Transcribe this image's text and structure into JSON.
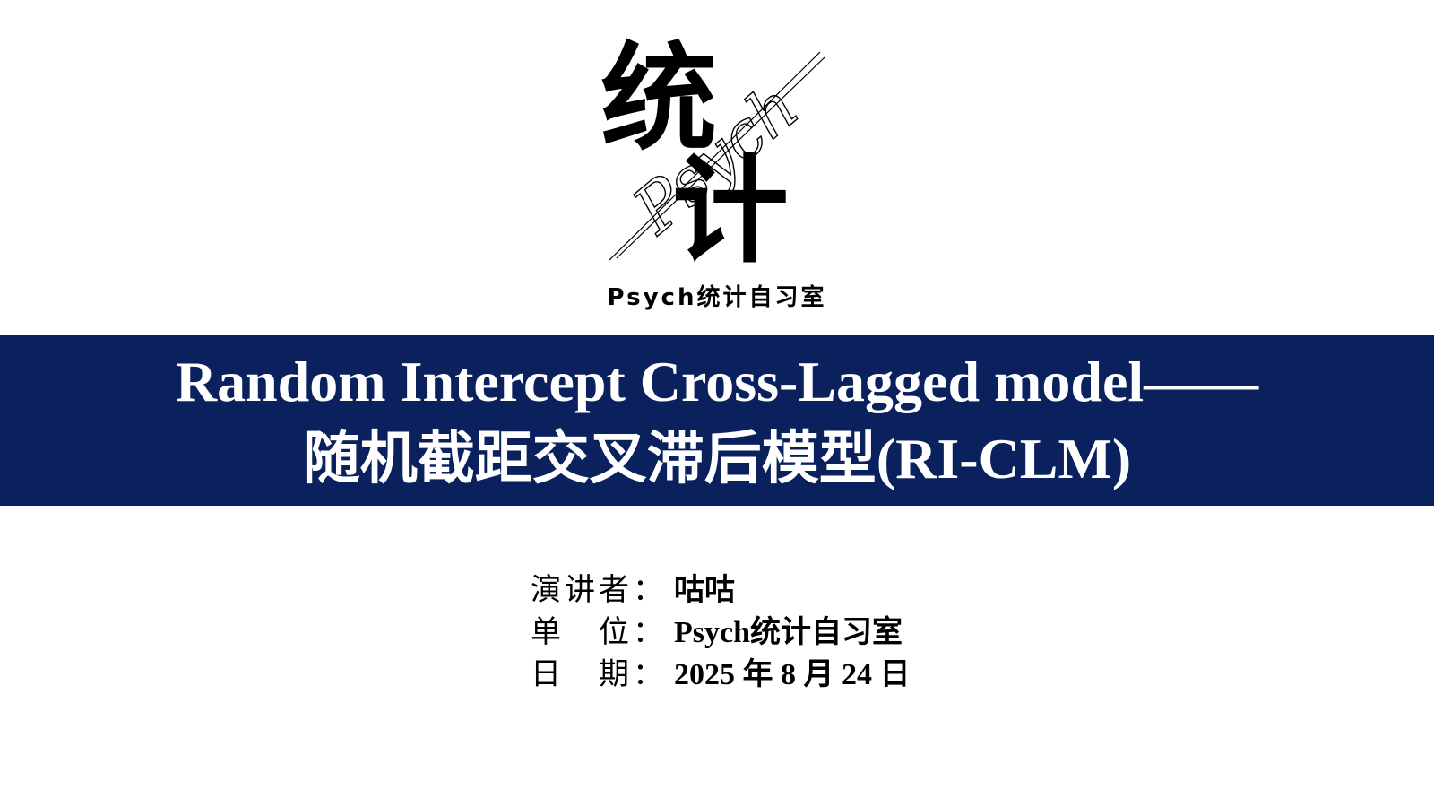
{
  "logo": {
    "glyph_top": "统",
    "glyph_bottom": "计",
    "signature": "Psych",
    "caption": "Psych统计自习室"
  },
  "banner": {
    "title_line1": "Random Intercept Cross-Lagged model——",
    "title_line2": "随机截距交叉滞后模型(RI-CLM)",
    "background": "#0b215e"
  },
  "info": {
    "presenter_label": "演讲者：",
    "presenter_value": "咕咕",
    "unit_label": "单　位：",
    "unit_value": "Psych统计自习室",
    "date_label": "日　期：",
    "date_value": "2025 年 8 月 24 日"
  }
}
